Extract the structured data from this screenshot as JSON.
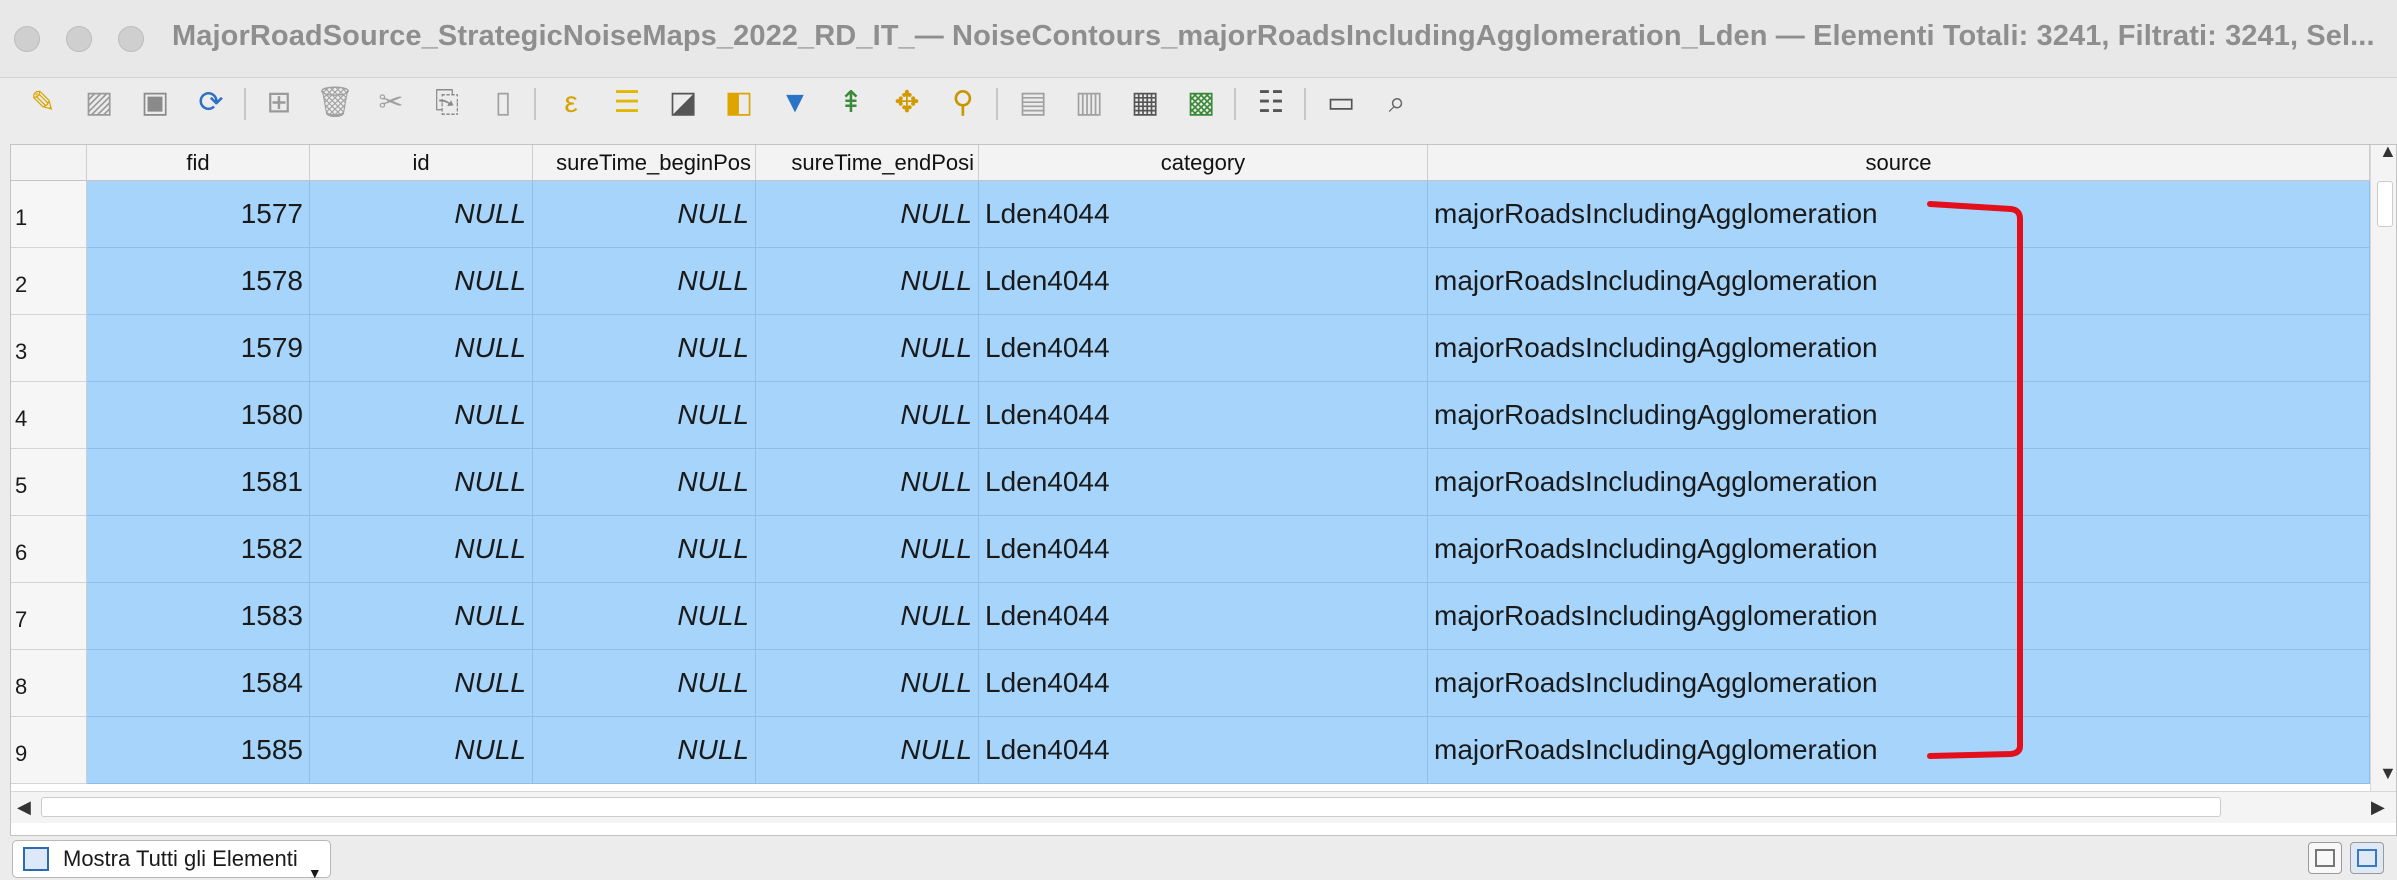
{
  "window": {
    "title": "MajorRoadSource_StrategicNoiseMaps_2022_RD_IT_— NoiseContours_majorRoadsIncludingAgglomeration_Lden — Elementi Totali: 3241, Filtrati: 3241, Sel..."
  },
  "toolbar": {
    "icons": [
      "pencil-edit-icon",
      "multi-edit-icon",
      "save-edits-icon",
      "reload-icon",
      "add-feature-icon",
      "delete-feature-icon",
      "cut-icon",
      "copy-icon",
      "paste-icon",
      "expression-select-icon",
      "select-all-icon",
      "invert-selection-icon",
      "deselect-icon",
      "filter-icon",
      "move-selection-top-icon",
      "pan-to-selection-icon",
      "zoom-to-selection-icon",
      "new-field-icon",
      "delete-field-icon",
      "field-calculator-icon",
      "conditional-format-icon",
      "attribute-actions-icon",
      "dock-icon",
      "zoom-identify-icon"
    ]
  },
  "table": {
    "columns": [
      "fid",
      "id",
      "sureTime_beginPos",
      "sureTime_endPosi",
      "category",
      "source"
    ],
    "rows": [
      {
        "num": "1",
        "fid": "1577",
        "id": "NULL",
        "begin": "NULL",
        "end": "NULL",
        "category": "Lden4044",
        "source": "majorRoadsIncludingAgglomeration"
      },
      {
        "num": "2",
        "fid": "1578",
        "id": "NULL",
        "begin": "NULL",
        "end": "NULL",
        "category": "Lden4044",
        "source": "majorRoadsIncludingAgglomeration"
      },
      {
        "num": "3",
        "fid": "1579",
        "id": "NULL",
        "begin": "NULL",
        "end": "NULL",
        "category": "Lden4044",
        "source": "majorRoadsIncludingAgglomeration"
      },
      {
        "num": "4",
        "fid": "1580",
        "id": "NULL",
        "begin": "NULL",
        "end": "NULL",
        "category": "Lden4044",
        "source": "majorRoadsIncludingAgglomeration"
      },
      {
        "num": "5",
        "fid": "1581",
        "id": "NULL",
        "begin": "NULL",
        "end": "NULL",
        "category": "Lden4044",
        "source": "majorRoadsIncludingAgglomeration"
      },
      {
        "num": "6",
        "fid": "1582",
        "id": "NULL",
        "begin": "NULL",
        "end": "NULL",
        "category": "Lden4044",
        "source": "majorRoadsIncludingAgglomeration"
      },
      {
        "num": "7",
        "fid": "1583",
        "id": "NULL",
        "begin": "NULL",
        "end": "NULL",
        "category": "Lden4044",
        "source": "majorRoadsIncludingAgglomeration"
      },
      {
        "num": "8",
        "fid": "1584",
        "id": "NULL",
        "begin": "NULL",
        "end": "NULL",
        "category": "Lden4044",
        "source": "majorRoadsIncludingAgglomeration"
      },
      {
        "num": "9",
        "fid": "1585",
        "id": "NULL",
        "begin": "NULL",
        "end": "NULL",
        "category": "Lden4044",
        "source": "majorRoadsIncludingAgglomeration"
      }
    ]
  },
  "bottom": {
    "show_all_label": "Mostra Tutti gli Elementi"
  },
  "colors": {
    "selection": "#a6d4fb",
    "annotation": "#e3101b"
  }
}
